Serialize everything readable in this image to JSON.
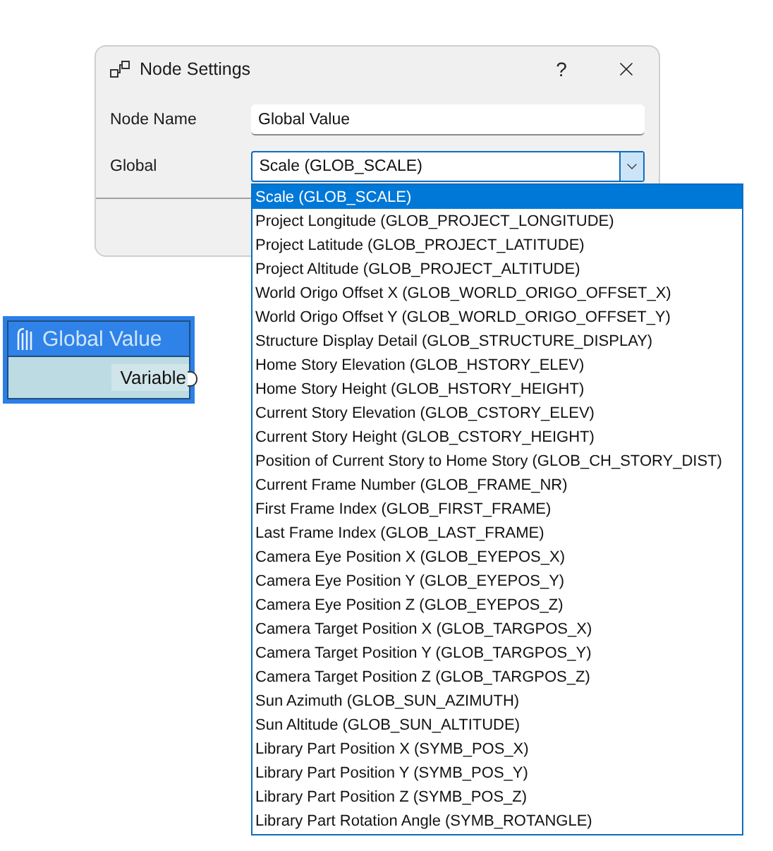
{
  "dialog": {
    "title": "Node Settings",
    "help": "?",
    "node_name": {
      "label": "Node Name",
      "value": "Global Value"
    },
    "global": {
      "label": "Global",
      "value": "Scale (GLOB_SCALE)"
    }
  },
  "dropdown": {
    "options": [
      {
        "label": "Scale (GLOB_SCALE)",
        "selected": true
      },
      {
        "label": "Project Longitude (GLOB_PROJECT_LONGITUDE)",
        "selected": false
      },
      {
        "label": "Project Latitude (GLOB_PROJECT_LATITUDE)",
        "selected": false
      },
      {
        "label": "Project Altitude (GLOB_PROJECT_ALTITUDE)",
        "selected": false
      },
      {
        "label": "World Origo Offset X (GLOB_WORLD_ORIGO_OFFSET_X)",
        "selected": false
      },
      {
        "label": "World Origo Offset Y (GLOB_WORLD_ORIGO_OFFSET_Y)",
        "selected": false
      },
      {
        "label": "Structure Display Detail (GLOB_STRUCTURE_DISPLAY)",
        "selected": false
      },
      {
        "label": "Home Story Elevation (GLOB_HSTORY_ELEV)",
        "selected": false
      },
      {
        "label": "Home Story Height (GLOB_HSTORY_HEIGHT)",
        "selected": false
      },
      {
        "label": "Current Story Elevation (GLOB_CSTORY_ELEV)",
        "selected": false
      },
      {
        "label": "Current Story Height (GLOB_CSTORY_HEIGHT)",
        "selected": false
      },
      {
        "label": "Position of Current Story to Home Story (GLOB_CH_STORY_DIST)",
        "selected": false
      },
      {
        "label": "Current Frame Number (GLOB_FRAME_NR)",
        "selected": false
      },
      {
        "label": "First Frame Index (GLOB_FIRST_FRAME)",
        "selected": false
      },
      {
        "label": "Last Frame Index (GLOB_LAST_FRAME)",
        "selected": false
      },
      {
        "label": "Camera Eye Position X (GLOB_EYEPOS_X)",
        "selected": false
      },
      {
        "label": "Camera Eye Position Y (GLOB_EYEPOS_Y)",
        "selected": false
      },
      {
        "label": "Camera Eye Position Z (GLOB_EYEPOS_Z)",
        "selected": false
      },
      {
        "label": "Camera Target Position X (GLOB_TARGPOS_X)",
        "selected": false
      },
      {
        "label": "Camera Target Position Y (GLOB_TARGPOS_Y)",
        "selected": false
      },
      {
        "label": "Camera Target Position Z (GLOB_TARGPOS_Z)",
        "selected": false
      },
      {
        "label": "Sun Azimuth (GLOB_SUN_AZIMUTH)",
        "selected": false
      },
      {
        "label": "Sun Altitude (GLOB_SUN_ALTITUDE)",
        "selected": false
      },
      {
        "label": "Library Part Position X (SYMB_POS_X)",
        "selected": false
      },
      {
        "label": "Library Part Position Y (SYMB_POS_Y)",
        "selected": false
      },
      {
        "label": "Library Part Position Z (SYMB_POS_Z)",
        "selected": false
      },
      {
        "label": "Library Part Rotation Angle (SYMB_ROTANGLE)",
        "selected": false
      }
    ]
  },
  "node": {
    "title": "Global Value",
    "port_label": "Variable"
  }
}
